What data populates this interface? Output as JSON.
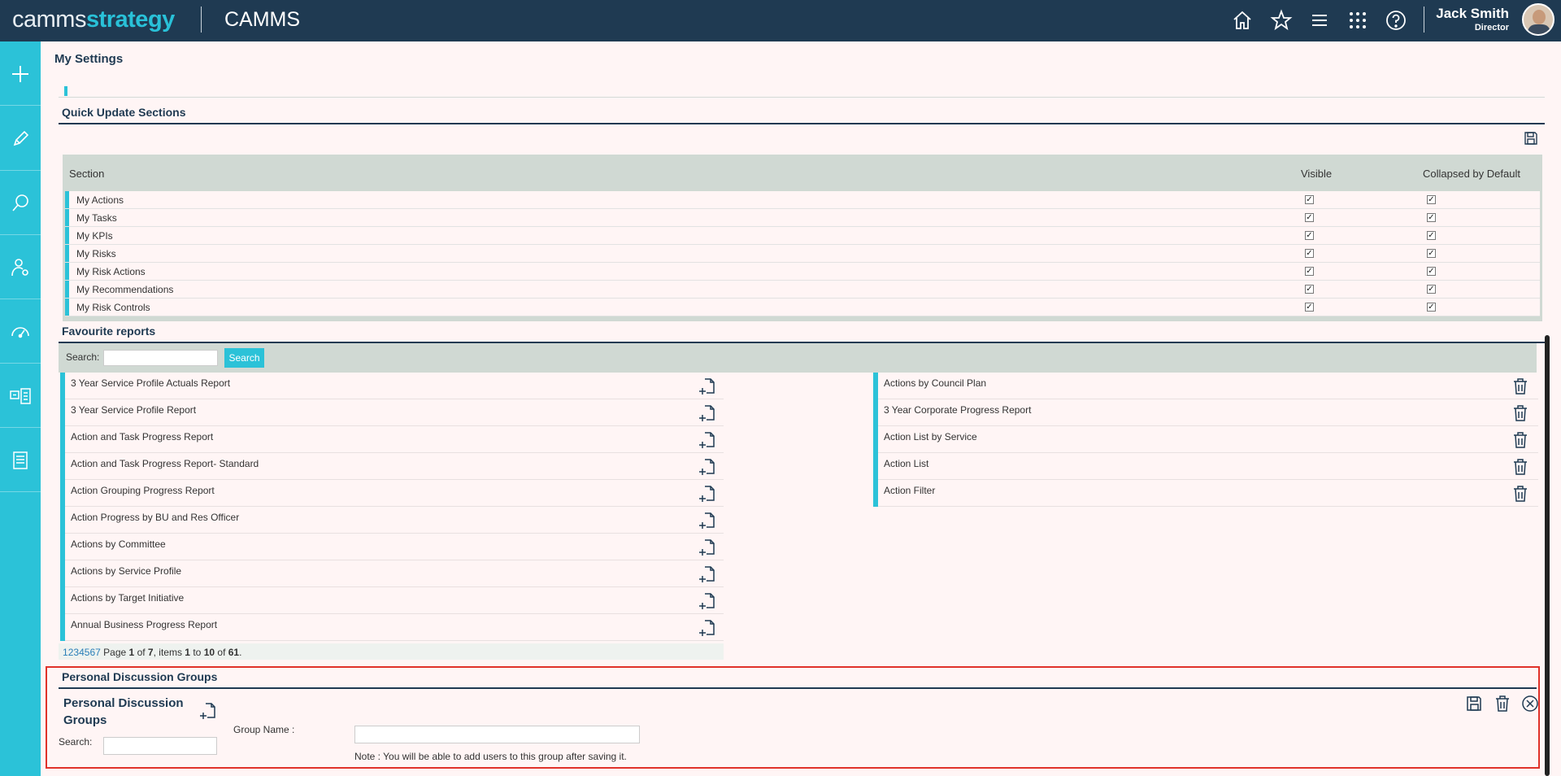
{
  "header": {
    "logo_part1": "camms",
    "logo_part2": "strategy",
    "app_name": "CAMMS",
    "icons": [
      "home-icon",
      "star-icon",
      "menu-icon",
      "apps-grid-icon",
      "help-icon"
    ],
    "user_name": "Jack Smith",
    "user_role": "Director"
  },
  "sidebar": {
    "items": [
      "plus-icon",
      "pencil-icon",
      "search-icon",
      "user-settings-icon",
      "dashboard-gauge-icon",
      "cards-icon",
      "document-icon"
    ]
  },
  "page": {
    "title": "My Settings"
  },
  "quick_update": {
    "title": "Quick Update Sections",
    "columns": [
      "Section",
      "Visible",
      "Collapsed by Default"
    ],
    "rows": [
      {
        "section": "My Actions",
        "visible": true,
        "collapsed": true
      },
      {
        "section": "My Tasks",
        "visible": true,
        "collapsed": true
      },
      {
        "section": "My KPIs",
        "visible": true,
        "collapsed": true
      },
      {
        "section": "My Risks",
        "visible": true,
        "collapsed": true
      },
      {
        "section": "My Risk Actions",
        "visible": true,
        "collapsed": true
      },
      {
        "section": "My Recommendations",
        "visible": true,
        "collapsed": true
      },
      {
        "section": "My Risk Controls",
        "visible": true,
        "collapsed": true
      }
    ]
  },
  "favourite_reports": {
    "title": "Favourite reports",
    "search_label": "Search:",
    "search_value": "",
    "search_button": "Search",
    "available": [
      "3 Year Service Profile Actuals Report",
      "3 Year Service Profile Report",
      "Action and Task Progress Report",
      "Action and Task Progress Report- Standard",
      "Action Grouping Progress Report",
      "Action Progress by BU and Res Officer",
      "Actions by Committee",
      "Actions by Service Profile",
      "Actions by Target Initiative",
      "Annual Business Progress Report"
    ],
    "favourites": [
      "Actions by Council Plan",
      "3 Year Corporate Progress Report",
      "Action List by Service",
      "Action List",
      "Action Filter"
    ],
    "pager": {
      "pages": [
        "1",
        "2",
        "3",
        "4",
        "5",
        "6",
        "7"
      ],
      "text_page": "Page",
      "current_page": "1",
      "text_of": "of",
      "total_pages": "7",
      "text_items": ", items",
      "from": "1",
      "text_to": "to",
      "to": "10",
      "text_of2": "of",
      "total": "61",
      "text_end": "."
    }
  },
  "discussion_groups": {
    "title": "Personal Discussion Groups",
    "subtitle_line1": "Personal Discussion",
    "subtitle_line2": "Groups",
    "search_label": "Search:",
    "search_value": "",
    "group_name_label": "Group Name :",
    "group_name_value": "",
    "note": "Note : You will be able to add users to this group after saving it."
  }
}
